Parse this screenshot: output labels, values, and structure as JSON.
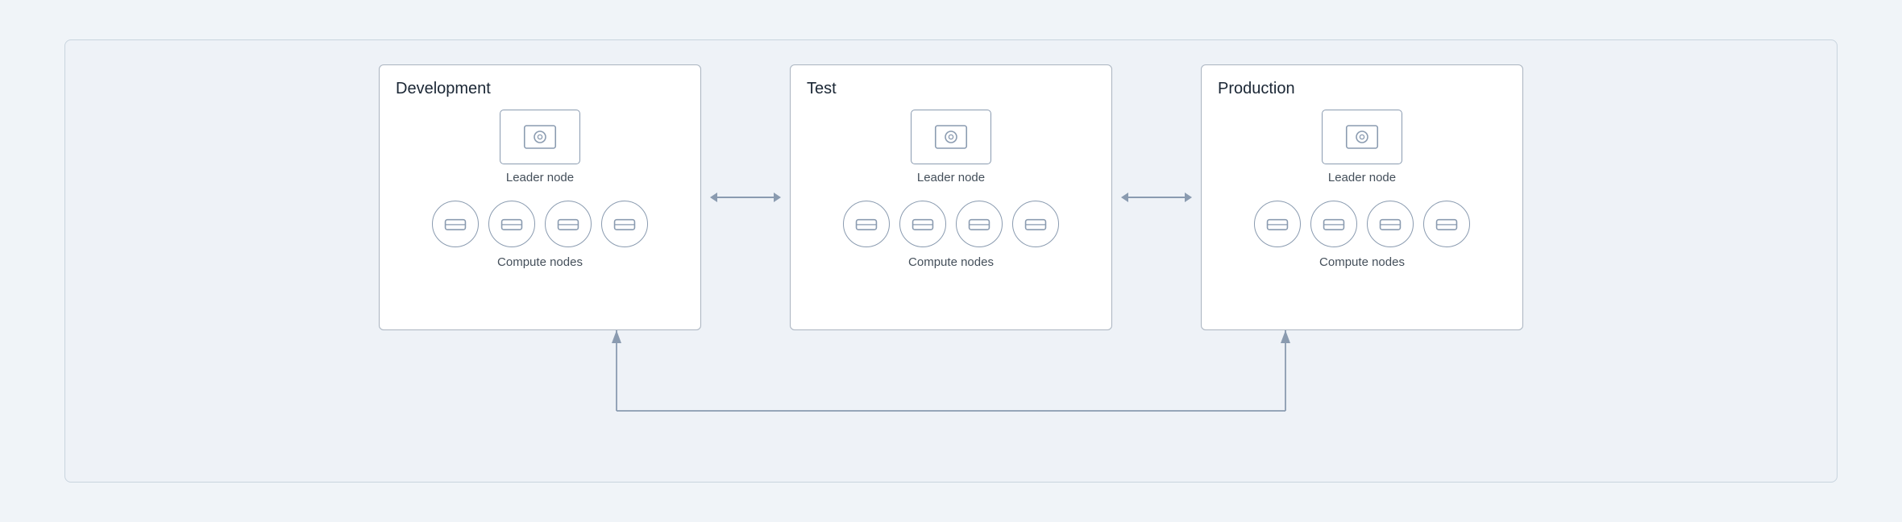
{
  "diagram": {
    "background_color": "#eef2f7",
    "environments": [
      {
        "id": "development",
        "title": "Development",
        "leader_label": "Leader node",
        "compute_label": "Compute nodes",
        "compute_count": 4
      },
      {
        "id": "test",
        "title": "Test",
        "leader_label": "Leader node",
        "compute_label": "Compute nodes",
        "compute_count": 4
      },
      {
        "id": "production",
        "title": "Production",
        "leader_label": "Leader node",
        "compute_label": "Compute nodes",
        "compute_count": 4
      }
    ],
    "arrows": {
      "horizontal_between_dev_test": "↔",
      "horizontal_between_test_prod": "↔",
      "bottom_connector_label": ""
    }
  }
}
